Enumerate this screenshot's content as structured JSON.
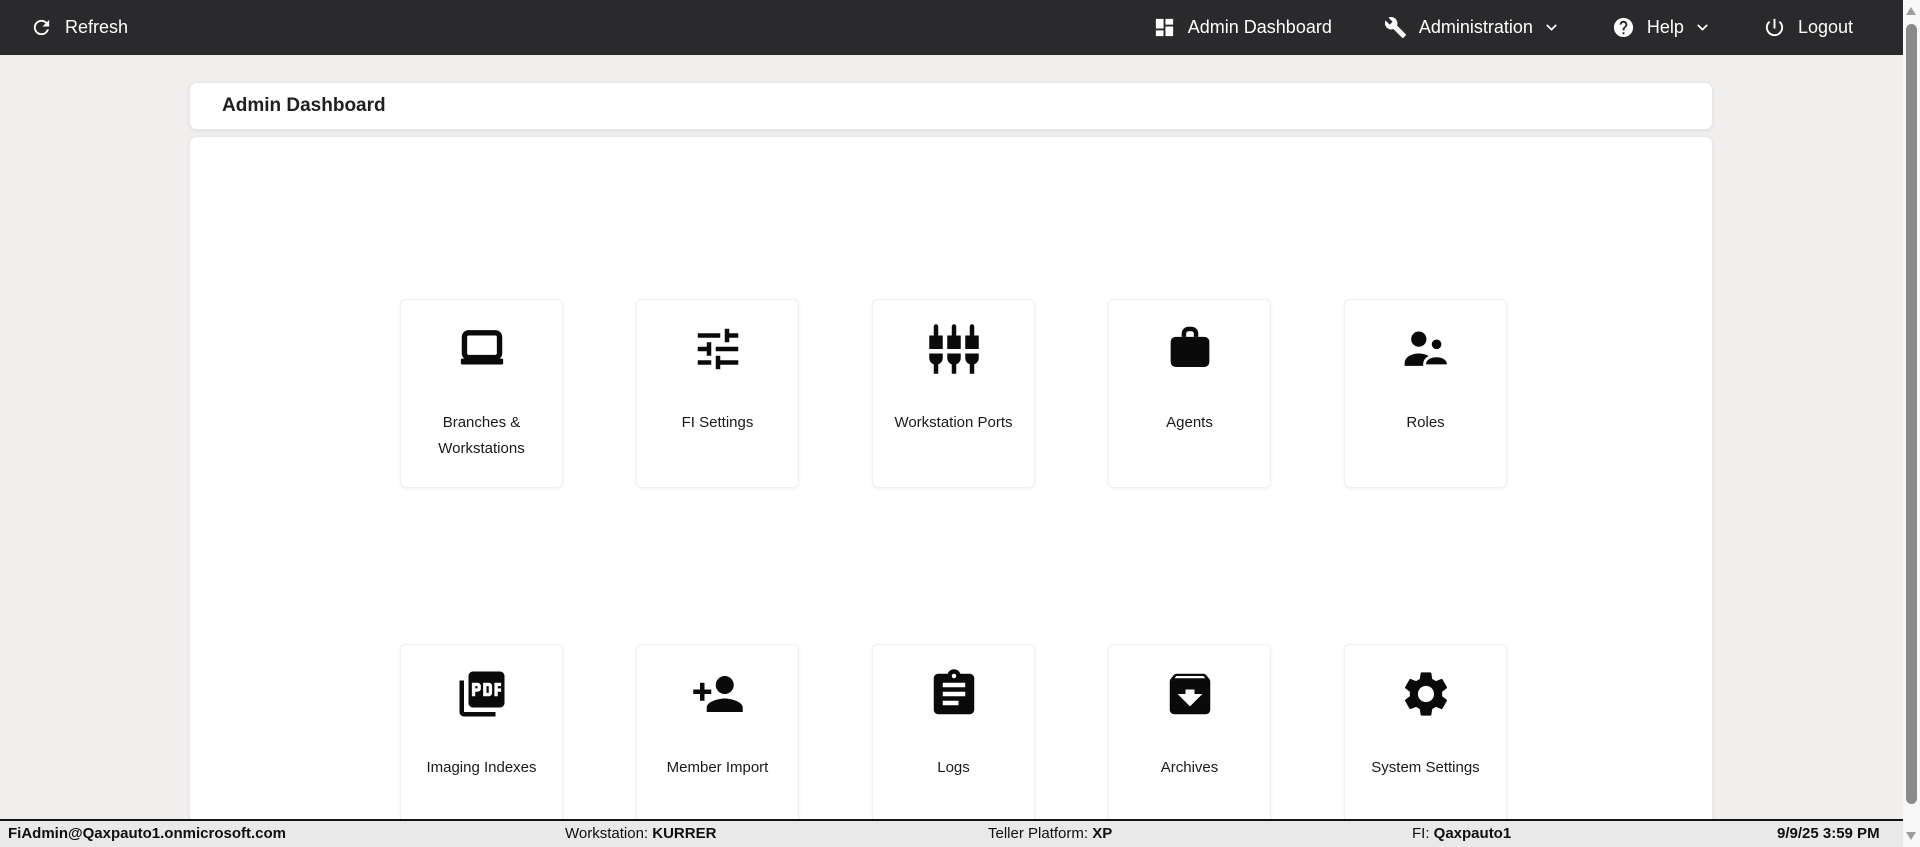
{
  "navbar": {
    "refresh_label": "Refresh",
    "dashboard_label": "Admin Dashboard",
    "administration_label": "Administration",
    "help_label": "Help",
    "logout_label": "Logout"
  },
  "header": {
    "title": "Admin Dashboard"
  },
  "tiles": [
    {
      "label": "Branches & Workstations",
      "icon": "laptop-icon"
    },
    {
      "label": "FI Settings",
      "icon": "tune-sliders-icon"
    },
    {
      "label": "Workstation Ports",
      "icon": "input-component-icon"
    },
    {
      "label": "Agents",
      "icon": "briefcase-icon"
    },
    {
      "label": "Roles",
      "icon": "people-icon"
    },
    {
      "label": "Imaging Indexes",
      "icon": "pdf-document-icon"
    },
    {
      "label": "Member Import",
      "icon": "person-add-icon"
    },
    {
      "label": "Logs",
      "icon": "clipboard-icon"
    },
    {
      "label": "Archives",
      "icon": "archive-icon"
    },
    {
      "label": "System Settings",
      "icon": "gear-icon"
    }
  ],
  "statusbar": {
    "user": "FiAdmin@Qaxpauto1.onmicrosoft.com",
    "workstation_label": "Workstation: ",
    "workstation_value": "KURRER",
    "platform_label": "Teller Platform: ",
    "platform_value": "XP",
    "fi_label": "FI: ",
    "fi_value": "Qaxpauto1",
    "timestamp": "9/9/25 3:59 PM"
  },
  "colors": {
    "navbar_bg": "#2a2a2c",
    "page_bg": "#f0efee",
    "card_bg": "#ffffff",
    "statusbar_bg": "#e9e9e9",
    "icon_color": "#0a0a0a"
  }
}
